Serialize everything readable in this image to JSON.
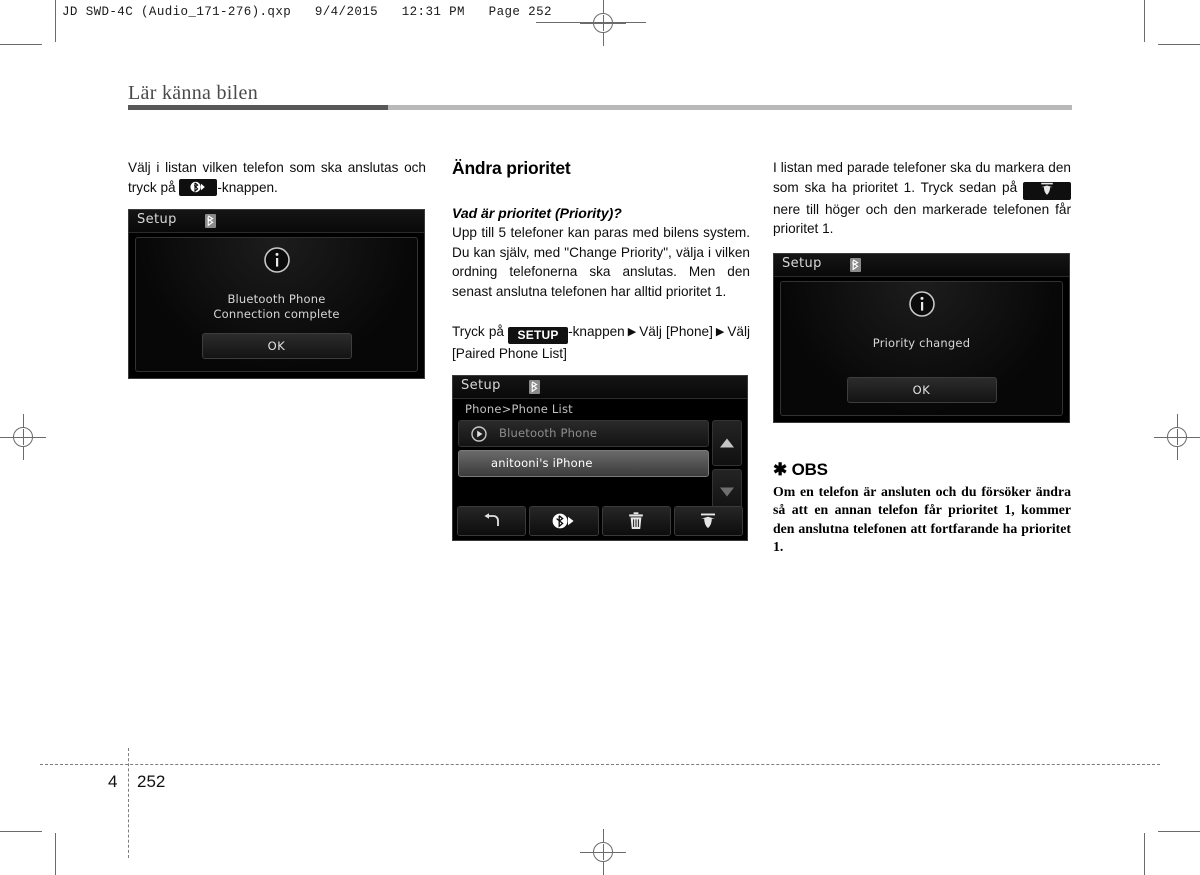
{
  "prepress": {
    "file_header": "JD SWD-4C (Audio_171-276).qxp   9/4/2015   12:31 PM   Page 252"
  },
  "chapter": {
    "title": "Lär känna bilen"
  },
  "columns": {
    "left": {
      "intro_before": "Välj i listan vilken telefon som ska anslutas och tryck på ",
      "intro_after": "-knappen.",
      "inline_button_icon": "bluetooth-connect-icon",
      "screenshot": {
        "title": "Setup",
        "status_icon": "bluetooth-icon",
        "info_icon": "info-circle-icon",
        "message_line1": "Bluetooth Phone",
        "message_line2": "Connection complete",
        "ok_label": "OK"
      }
    },
    "middle": {
      "heading": "Ändra prioritet",
      "subheading": "Vad är prioritet (Priority)?",
      "paragraph": "Upp till 5 telefoner kan paras med bilens system. Du kan själv, med \"Change Priority\", välja i vilken ordning telefonerna ska anslutas. Men den senast anslutna telefonen har alltid prioritet 1.",
      "path": {
        "part1": "Tryck på ",
        "setup_label": "SETUP",
        "part2": "-knappen",
        "arrow": "▶",
        "part3": "Välj [Phone]",
        "part4": "Välj [Paired Phone List]"
      },
      "screenshot": {
        "title": "Setup",
        "status_icon": "bluetooth-icon",
        "breadcrumb": "Phone>Phone List",
        "rows": [
          {
            "label": "Bluetooth Phone",
            "icon": "play-circle-icon",
            "selected": false
          },
          {
            "label": "anitooni's iPhone",
            "icon": "",
            "selected": true
          }
        ],
        "scroll_up_icon": "triangle-up-icon",
        "scroll_down_icon": "triangle-down-icon",
        "toolbar": [
          {
            "name": "back-button",
            "icon": "back-arrow-icon"
          },
          {
            "name": "connect-button",
            "icon": "bluetooth-connect-icon"
          },
          {
            "name": "delete-button",
            "icon": "trash-icon"
          },
          {
            "name": "priority-button",
            "icon": "priority-up-icon"
          }
        ]
      }
    },
    "right": {
      "paragraph_part1": "I listan med parade telefoner ska du markera den som ska ha prioritet 1. Tryck sedan på ",
      "inline_button_icon": "priority-up-icon",
      "paragraph_part2": " nere till höger och den markerade telefonen får prioritet 1.",
      "screenshot": {
        "title": "Setup",
        "status_icon": "bluetooth-icon",
        "info_icon": "info-circle-icon",
        "message_line1": "Priority changed",
        "message_line2": "",
        "ok_label": "OK"
      },
      "note": {
        "marker": "✱",
        "heading": "OBS",
        "body": "Om en telefon är ansluten och du försöker ändra så att en annan telefon får prioritet 1, kommer den anslutna telefonen att fortfarande ha prioritet 1."
      }
    }
  },
  "footer": {
    "chapter_number": "4",
    "page_number": "252"
  }
}
